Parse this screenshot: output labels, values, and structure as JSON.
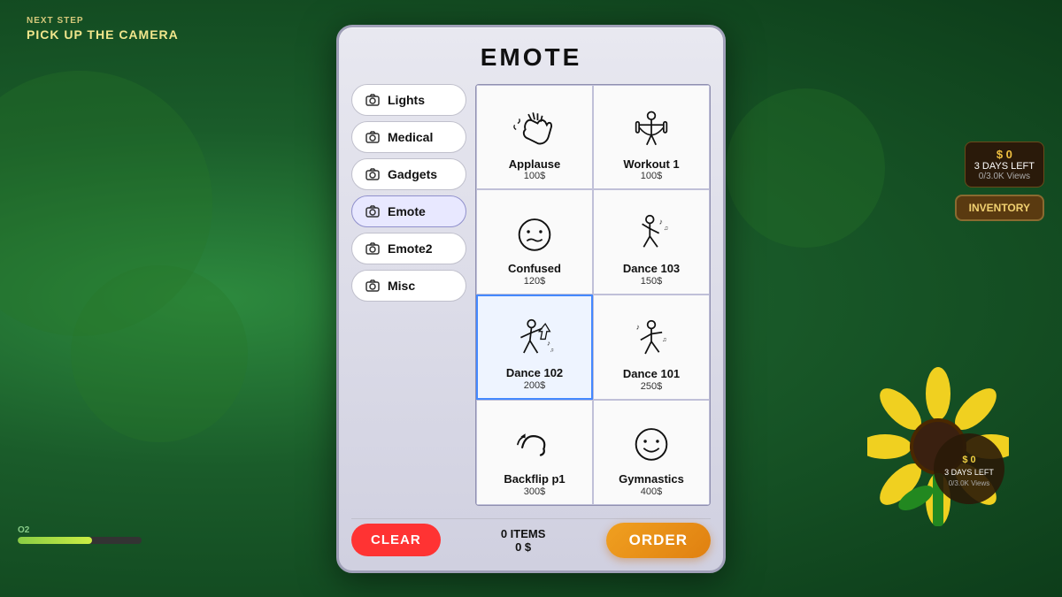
{
  "background": {
    "color": "#1a5c2a"
  },
  "hud": {
    "next_step_label": "NEXT STEP",
    "next_step_text": "PICK UP THE CAMERA"
  },
  "o2": {
    "label": "O2",
    "fill_percent": 60
  },
  "right_panel": {
    "money": "$ 0",
    "days_left": "3 DAYS LEFT",
    "views": "0/3.0K Views",
    "inventory_label": "INVENTORY"
  },
  "panel": {
    "title": "EMOTE",
    "nav_items": [
      {
        "id": "lights",
        "label": "Lights",
        "icon": "📷"
      },
      {
        "id": "medical",
        "label": "Medical",
        "icon": "📷"
      },
      {
        "id": "gadgets",
        "label": "Gadgets",
        "icon": "📷"
      },
      {
        "id": "emote",
        "label": "Emote",
        "icon": "📷",
        "active": true
      },
      {
        "id": "emote2",
        "label": "Emote2",
        "icon": "📷"
      },
      {
        "id": "misc",
        "label": "Misc",
        "icon": "📷"
      }
    ],
    "grid_items": [
      {
        "id": "applause",
        "name": "Applause",
        "price": "100$",
        "icon": "applause"
      },
      {
        "id": "workout1",
        "name": "Workout 1",
        "price": "100$",
        "icon": "workout"
      },
      {
        "id": "confused",
        "name": "Confused",
        "price": "120$",
        "icon": "confused"
      },
      {
        "id": "dance103",
        "name": "Dance 103",
        "price": "150$",
        "icon": "dance103"
      },
      {
        "id": "dance102",
        "name": "Dance 102",
        "price": "200$",
        "icon": "dance102",
        "selected": true
      },
      {
        "id": "dance101",
        "name": "Dance 101",
        "price": "250$",
        "icon": "dance101"
      },
      {
        "id": "backflip",
        "name": "Backflip p1",
        "price": "300$",
        "icon": "backflip"
      },
      {
        "id": "gymnastics",
        "name": "Gymnastics",
        "price": "400$",
        "icon": "gymnastics"
      }
    ],
    "bottom": {
      "clear_label": "CLEAR",
      "items_count": "0 ITEMS",
      "items_total": "0 $",
      "order_label": "ORDER"
    }
  }
}
